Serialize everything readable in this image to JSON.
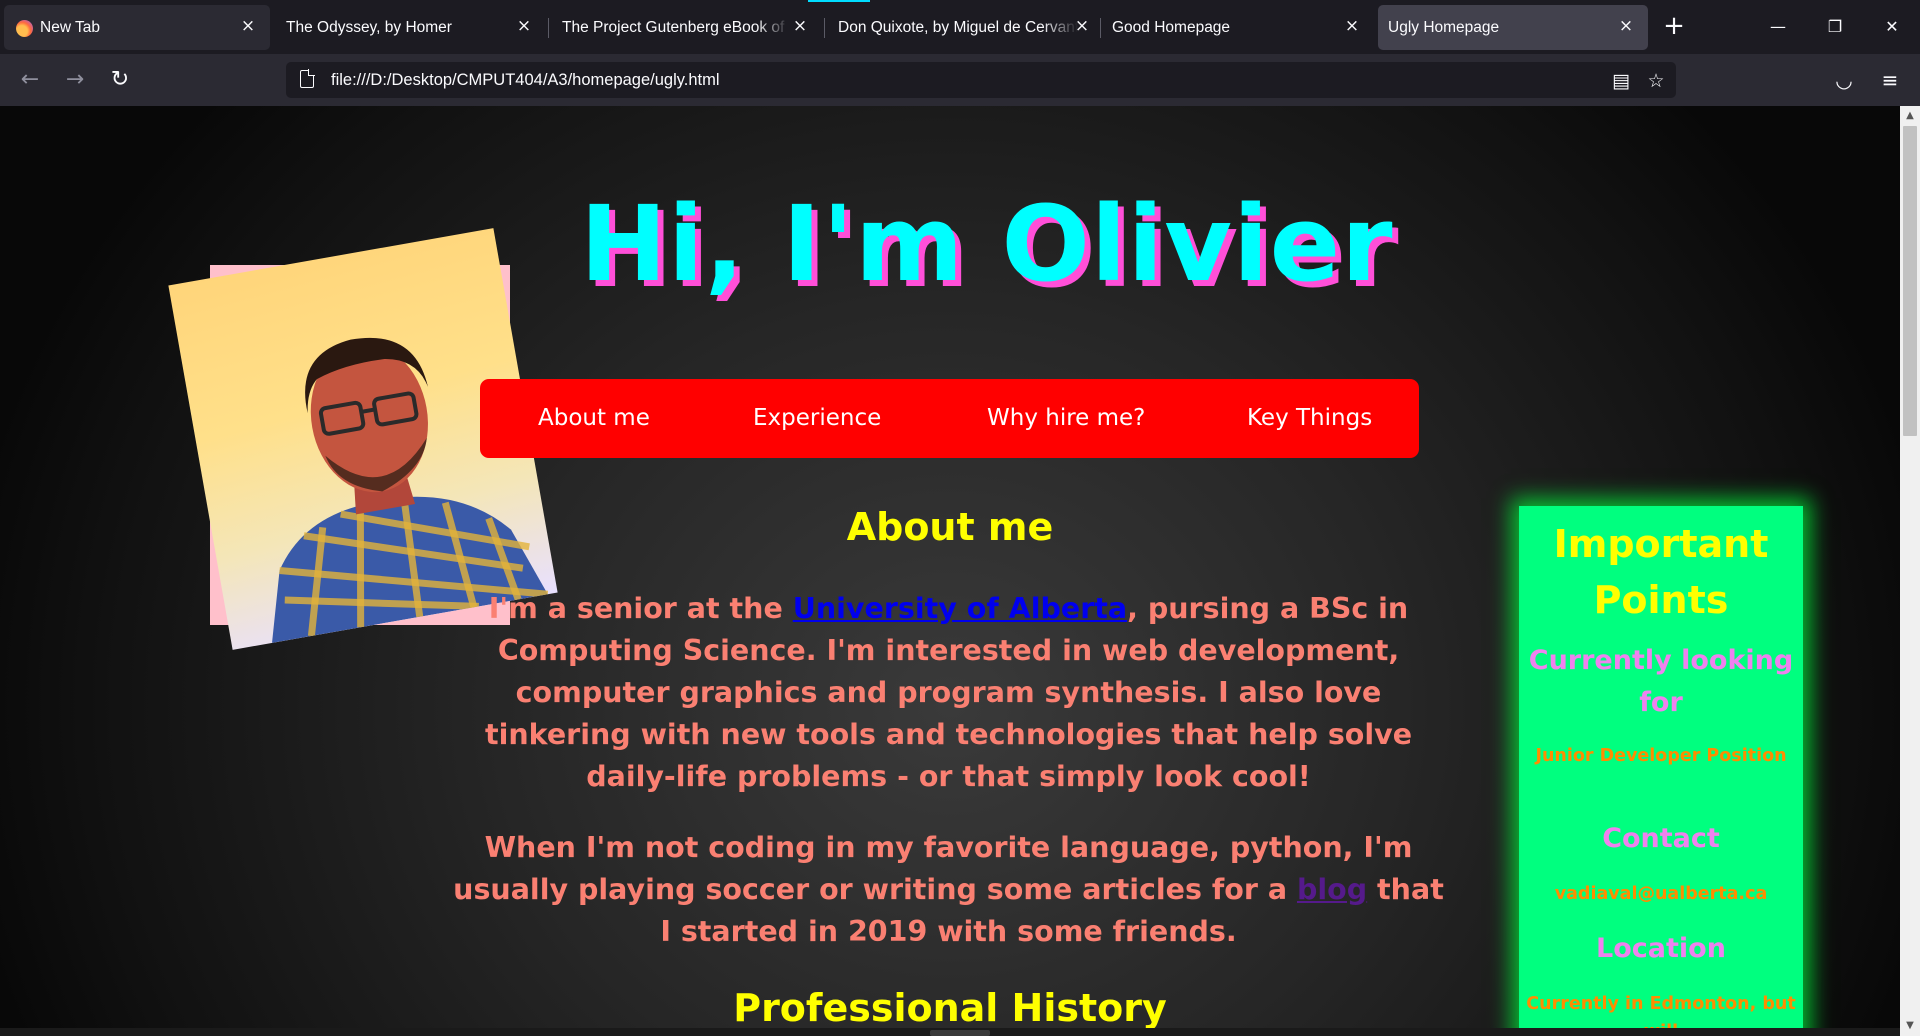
{
  "browser": {
    "tabs": [
      {
        "label": "New Tab",
        "active": false
      },
      {
        "label": "The Odyssey, by Homer",
        "active": false
      },
      {
        "label": "The Project Gutenberg eBook of Don",
        "active": false
      },
      {
        "label": "Don Quixote, by Miguel de Cervantes",
        "active": false
      },
      {
        "label": "Good Homepage",
        "active": false
      },
      {
        "label": "Ugly Homepage",
        "active": true
      }
    ],
    "close_glyph": "×",
    "new_tab_glyph": "+",
    "url": "file:///D:/Desktop/CMPUT404/A3/homepage/ugly.html",
    "icons": {
      "back": "back-arrow-icon",
      "forward": "forward-arrow-icon",
      "reload": "reload-icon",
      "reader": "reader-view-icon",
      "bookmark": "bookmark-star-icon",
      "pocket": "pocket-icon",
      "menu": "hamburger-menu-icon"
    },
    "glyphs": {
      "back": "←",
      "forward": "→",
      "reload": "↻",
      "reader": "▤",
      "star": "☆",
      "pocket": "◡",
      "menu": "≡",
      "minimize": "—",
      "restore": "❐",
      "close": "✕"
    }
  },
  "page": {
    "headline": "Hi, I'm Olivier",
    "menu": [
      "About me",
      "Experience",
      "Why hire me?",
      "Key Things"
    ],
    "about_heading": "About me",
    "para1": {
      "before": "I'm a senior at the ",
      "link": "University of Alberta",
      "after": ", pursing a BSc in Computing Science. I'm interested in web development, computer graphics and program synthesis. I also love tinkering with new tools and technologies that help solve daily-life problems - or that simply look cool!"
    },
    "para2": {
      "before": "When I'm not coding in my favorite language, python, I'm usually playing soccer or writing some articles for a ",
      "link": "blog",
      "after": " that I started in 2019 with some friends."
    },
    "history_heading": "Professional History",
    "sidebar": {
      "title": "Important Points",
      "looking_heading": "Currently looking for",
      "looking_text": "Junior Developer Position",
      "contact_heading": "Contact",
      "contact_text": "vadiaval@ualberta.ca",
      "location_heading": "Location",
      "location_text": "Currently in Edmonton, but will"
    },
    "colors": {
      "headline": "#00ffff",
      "headline_shadow": "#ff4fd8",
      "menu_bg": "#ff0000",
      "heading": "#ffff00",
      "body_text": "#fa8072",
      "sidebar_bg": "#00ff7f",
      "sidebar_heading": "#ee82ee",
      "sidebar_text": "#ff8c00"
    }
  }
}
